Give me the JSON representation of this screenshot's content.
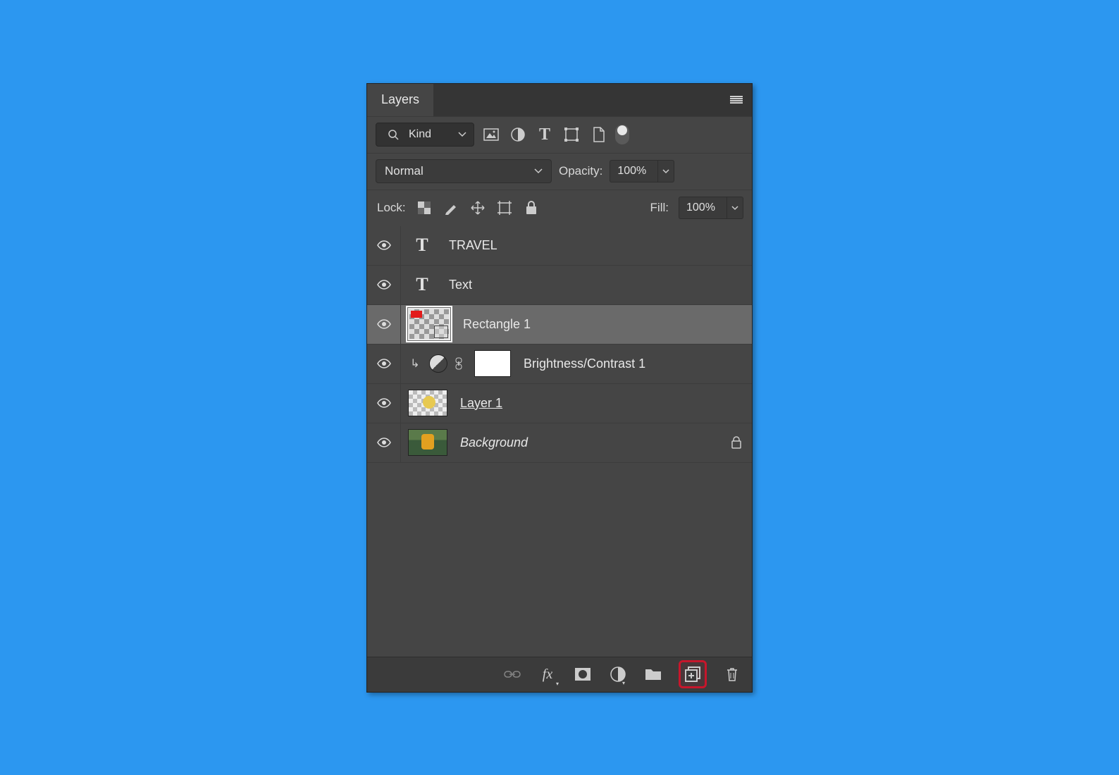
{
  "panel": {
    "title": "Layers"
  },
  "filter": {
    "label": "Kind"
  },
  "blend": {
    "mode": "Normal",
    "opacity_label": "Opacity:",
    "opacity_value": "100%"
  },
  "lock": {
    "label": "Lock:",
    "fill_label": "Fill:",
    "fill_value": "100%"
  },
  "layers": [
    {
      "name": "TRAVEL",
      "type": "text"
    },
    {
      "name": "Text",
      "type": "text"
    },
    {
      "name": "Rectangle 1",
      "type": "shape",
      "selected": true
    },
    {
      "name": "Brightness/Contrast 1",
      "type": "adjustment",
      "clipped": true
    },
    {
      "name": "Layer 1",
      "type": "smart"
    },
    {
      "name": "Background",
      "type": "background",
      "locked": true
    }
  ]
}
